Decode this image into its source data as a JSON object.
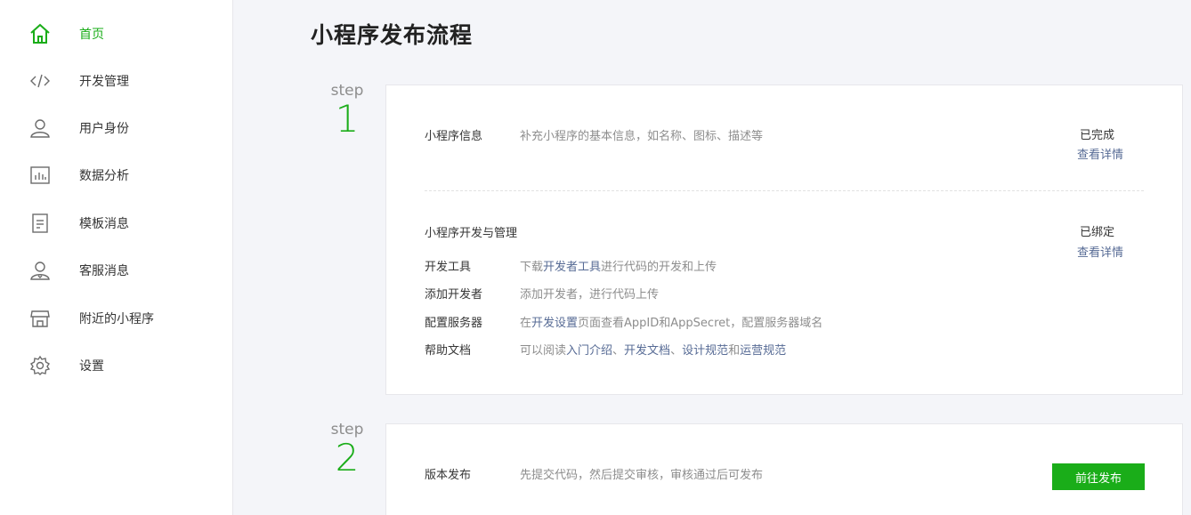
{
  "sidebar": {
    "items": [
      {
        "label": "首页",
        "icon": "home-icon",
        "active": true
      },
      {
        "label": "开发管理",
        "icon": "code-icon"
      },
      {
        "label": "用户身份",
        "icon": "user-icon"
      },
      {
        "label": "数据分析",
        "icon": "chart-icon"
      },
      {
        "label": "模板消息",
        "icon": "document-icon"
      },
      {
        "label": "客服消息",
        "icon": "support-user-icon"
      },
      {
        "label": "附近的小程序",
        "icon": "store-icon"
      },
      {
        "label": "设置",
        "icon": "gear-icon"
      }
    ]
  },
  "main": {
    "title": "小程序发布流程",
    "steps": [
      {
        "word": "step",
        "number": "1"
      },
      {
        "word": "step",
        "number": "2"
      }
    ],
    "card1": {
      "info": {
        "title": "小程序信息",
        "desc": "补充小程序的基本信息，如名称、图标、描述等",
        "status": "已完成",
        "detail": "查看详情"
      },
      "dev": {
        "title": "小程序开发与管理",
        "status": "已绑定",
        "detail": "查看详情",
        "rows": [
          {
            "title": "开发工具",
            "pre": "下载",
            "link": "开发者工具",
            "post": "进行代码的开发和上传"
          },
          {
            "title": "添加开发者",
            "text": "添加开发者，进行代码上传"
          },
          {
            "title": "配置服务器",
            "pre": "在",
            "link": "开发设置",
            "post": "页面查看AppID和AppSecret，配置服务器域名"
          },
          {
            "title": "帮助文档",
            "pre": "可以阅读",
            "link1": "入门介绍",
            "sep1": "、",
            "link2": "开发文档",
            "sep2": "、",
            "link3": "设计规范",
            "sep3": "和",
            "link4": "运营规范"
          }
        ]
      }
    },
    "card2": {
      "title": "版本发布",
      "desc": "先提交代码，然后提交审核，审核通过后可发布",
      "button": "前往发布"
    }
  },
  "colors": {
    "accent": "#1aad19",
    "link": "#576b95",
    "muted": "#8d8d8d",
    "background": "#f4f5f9"
  }
}
